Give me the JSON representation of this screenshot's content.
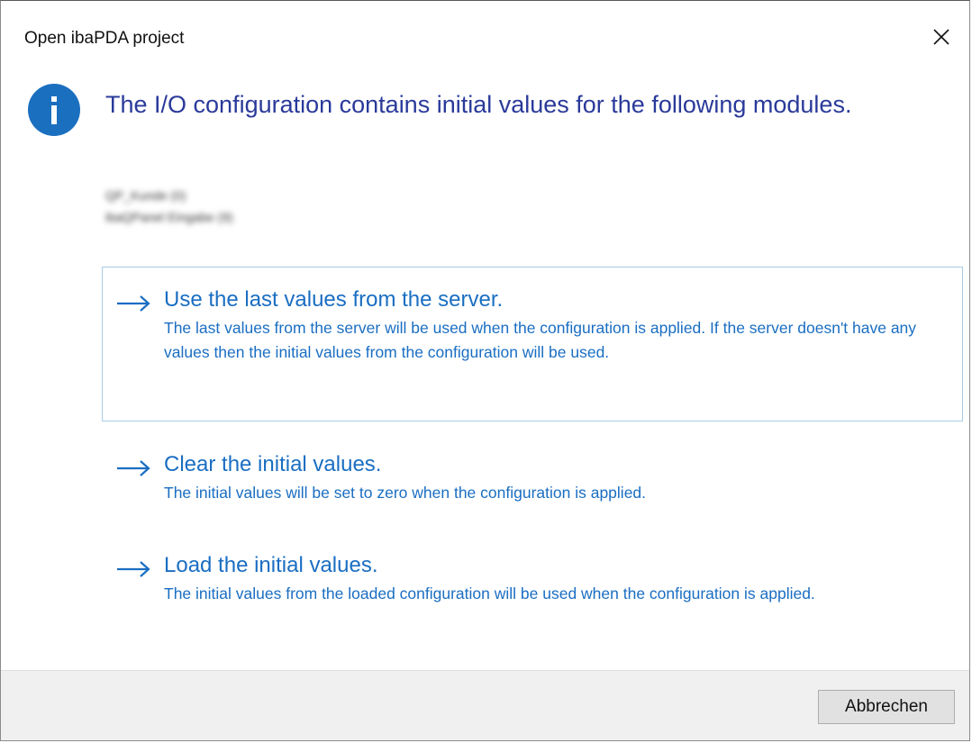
{
  "window": {
    "title": "Open ibaPDA project",
    "close_icon": "close-icon"
  },
  "main": {
    "icon": "info-icon",
    "instruction": "The I/O configuration contains initial values for the following modules.",
    "modules": [
      "QP_Kunde (0)",
      "ibaQPanel Eingabe (9)"
    ]
  },
  "commands": [
    {
      "title": "Use the last values from the server.",
      "description": "The last values from the server will be used when the configuration is applied. If the server doesn't have any values then the initial values from the configuration will be used."
    },
    {
      "title": "Clear the initial values.",
      "description": "The initial values will be set to zero when the configuration is applied."
    },
    {
      "title": "Load the initial values.",
      "description": "The initial values from the loaded configuration will be used when the configuration is applied."
    }
  ],
  "footer": {
    "cancel_label": "Abbrechen"
  },
  "colors": {
    "accent": "#1a6ec2",
    "instruction_text": "#2a3a9a",
    "info_icon_bg": "#1b6fbf",
    "footer_bg": "#f0f0f0"
  }
}
